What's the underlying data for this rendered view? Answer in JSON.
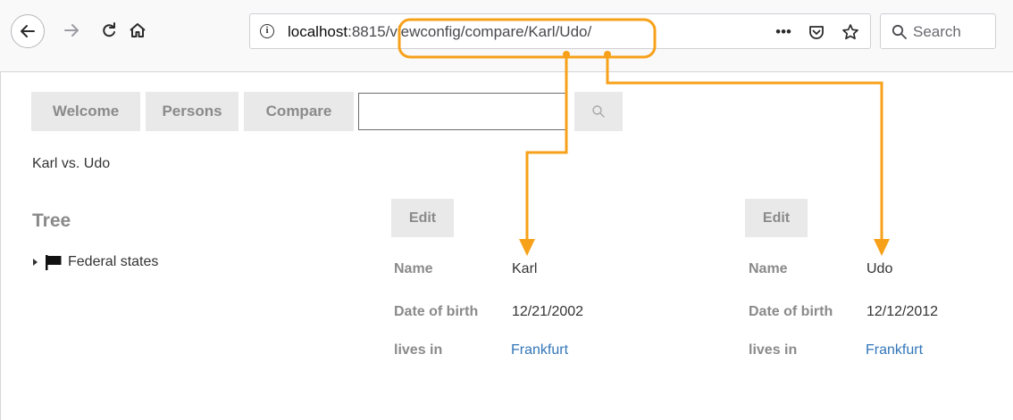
{
  "browser": {
    "url_host": "localhost",
    "url_rest": ":8815/viewconfig/compare/Karl/Udo/",
    "url_actions": "•••",
    "search_placeholder": "Search",
    "icons": [
      "back-icon",
      "forward-icon",
      "reload-icon",
      "home-icon",
      "info-icon",
      "pocket-icon",
      "star-icon",
      "search-icon"
    ]
  },
  "nav": {
    "tabs": [
      "Welcome",
      "Persons",
      "Compare"
    ],
    "search_value": ""
  },
  "page": {
    "subtitle": "Karl vs. Udo",
    "tree_title": "Tree",
    "tree_nodes": [
      "Federal states"
    ]
  },
  "persons": [
    {
      "edit_label": "Edit",
      "labels": [
        "Name",
        "Date of birth",
        "lives in"
      ],
      "name": "Karl",
      "birth": "12/21/2002",
      "city": "Frankfurt"
    },
    {
      "edit_label": "Edit",
      "labels": [
        "Name",
        "Date of birth",
        "lives in"
      ],
      "name": "Udo",
      "birth": "12/12/2012",
      "city": "Frankfurt"
    }
  ],
  "colors": {
    "annotation": "#f7a11a",
    "link": "#3276b8",
    "tab_bg": "#e9e9e9",
    "label": "#8a8a8a"
  }
}
